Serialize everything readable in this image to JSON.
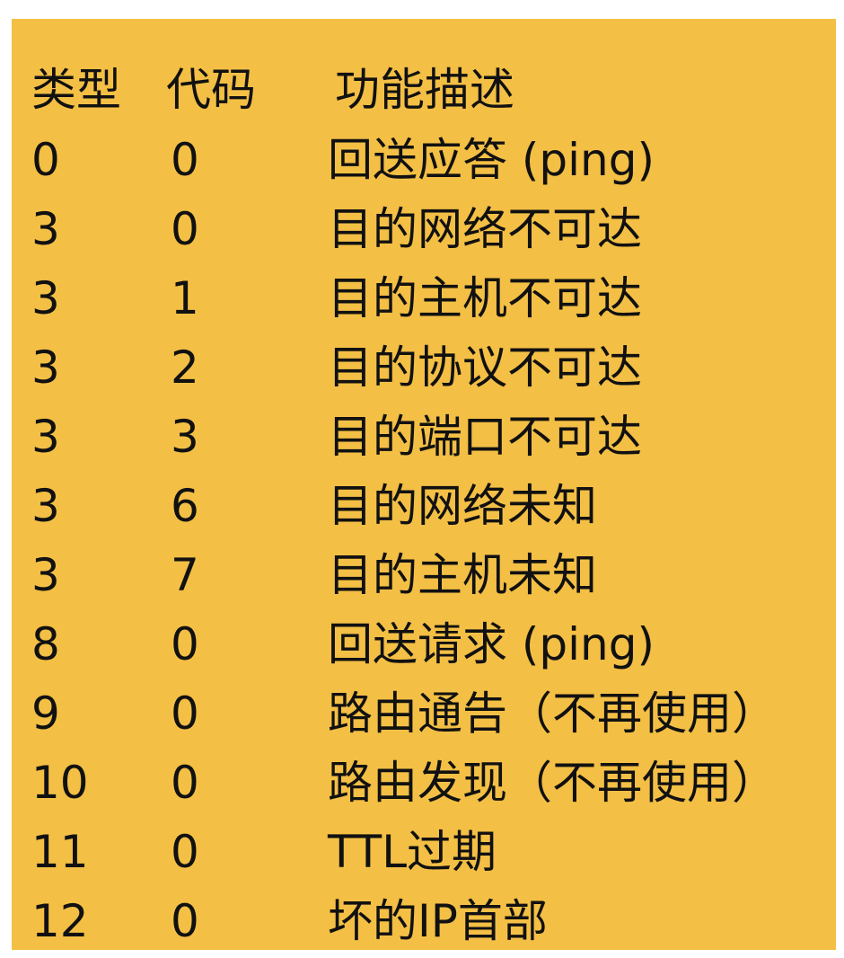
{
  "table": {
    "headers": {
      "type": "类型",
      "code": "代码",
      "description": "功能描述"
    },
    "rows": [
      {
        "type": "0",
        "code": "0",
        "description": "回送应答 (ping)"
      },
      {
        "type": "3",
        "code": "0",
        "description": "目的网络不可达"
      },
      {
        "type": "3",
        "code": "1",
        "description": "目的主机不可达"
      },
      {
        "type": "3",
        "code": "2",
        "description": "目的协议不可达"
      },
      {
        "type": "3",
        "code": "3",
        "description": "目的端口不可达"
      },
      {
        "type": "3",
        "code": "6",
        "description": "目的网络未知"
      },
      {
        "type": "3",
        "code": "7",
        "description": "目的主机未知"
      },
      {
        "type": "8",
        "code": "0",
        "description": "回送请求 (ping)"
      },
      {
        "type": "9",
        "code": "0",
        "description": "路由通告（不再使用）"
      },
      {
        "type": "10",
        "code": "0",
        "description": "路由发现（不再使用）"
      },
      {
        "type": "11",
        "code": "0",
        "description": "TTL过期"
      },
      {
        "type": "12",
        "code": "0",
        "description": "坏的IP首部"
      }
    ]
  },
  "colors": {
    "background": "#f3bf45",
    "text": "#111111"
  }
}
